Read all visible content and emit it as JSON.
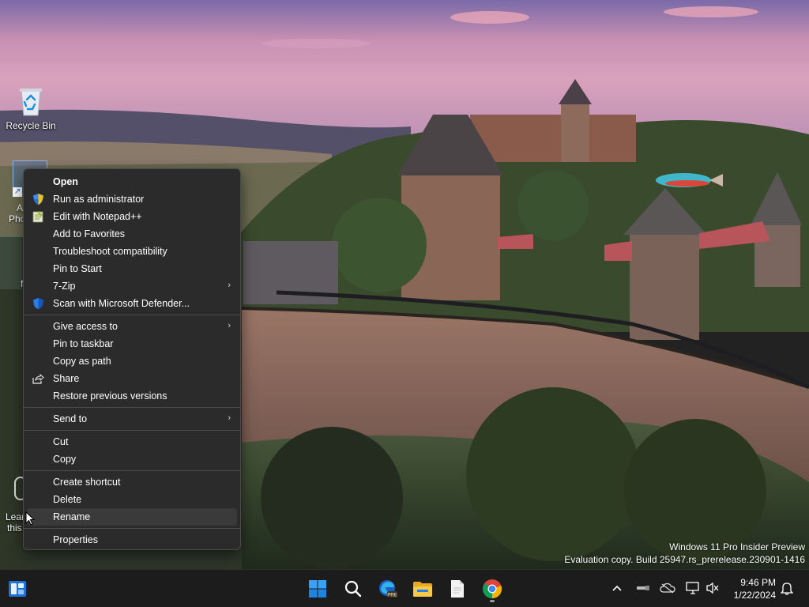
{
  "desktop": {
    "icons": [
      {
        "label": "Recycle Bin",
        "icon": "recycle-bin-icon"
      }
    ],
    "partial_labels": {
      "selected_item_line1": "A",
      "selected_item_line2": "Pho",
      "item_f": "f",
      "learn_line1": "Lear",
      "learn_line2": "this"
    }
  },
  "context_menu": {
    "items": [
      {
        "label": "Open",
        "icon": "",
        "bold": true
      },
      {
        "label": "Run as administrator",
        "icon": "uac-shield-icon"
      },
      {
        "label": "Edit with Notepad++",
        "icon": "notepadpp-icon"
      },
      {
        "label": "Add to Favorites",
        "icon": ""
      },
      {
        "label": "Troubleshoot compatibility",
        "icon": ""
      },
      {
        "label": "Pin to Start",
        "icon": ""
      },
      {
        "label": "7-Zip",
        "icon": "",
        "submenu": true
      },
      {
        "label": "Scan with Microsoft Defender...",
        "icon": "defender-shield-icon"
      },
      {
        "label": "Give access to",
        "icon": "",
        "submenu": true
      },
      {
        "label": "Pin to taskbar",
        "icon": ""
      },
      {
        "label": "Copy as path",
        "icon": ""
      },
      {
        "label": "Share",
        "icon": "share-icon"
      },
      {
        "label": "Restore previous versions",
        "icon": ""
      },
      {
        "label": "Send to",
        "icon": "",
        "submenu": true
      },
      {
        "label": "Cut",
        "icon": ""
      },
      {
        "label": "Copy",
        "icon": ""
      },
      {
        "label": "Create shortcut",
        "icon": ""
      },
      {
        "label": "Delete",
        "icon": ""
      },
      {
        "label": "Rename",
        "icon": "",
        "hover": true
      },
      {
        "label": "Properties",
        "icon": ""
      }
    ],
    "submenu_arrow": "›"
  },
  "watermark": {
    "line1": "Windows 11 Pro Insider Preview",
    "line2": "Evaluation copy. Build 25947.rs_prerelease.230901-1416"
  },
  "taskbar": {
    "apps": [
      "widgets-icon",
      "start-icon",
      "search-icon",
      "edge-dev-icon",
      "file-explorer-icon",
      "notepad-icon",
      "chrome-icon"
    ],
    "tray": [
      "chevron-up-icon",
      "usb-icon",
      "cloud-icon",
      "network-icon",
      "speaker-muted-icon",
      "notification-bell-icon"
    ],
    "time": "9:46 PM",
    "date": "1/22/2024"
  },
  "colors": {
    "menu_bg": "#2b2b2b",
    "taskbar_bg": "#1c1c1c",
    "accent_blue": "#0078d4"
  }
}
